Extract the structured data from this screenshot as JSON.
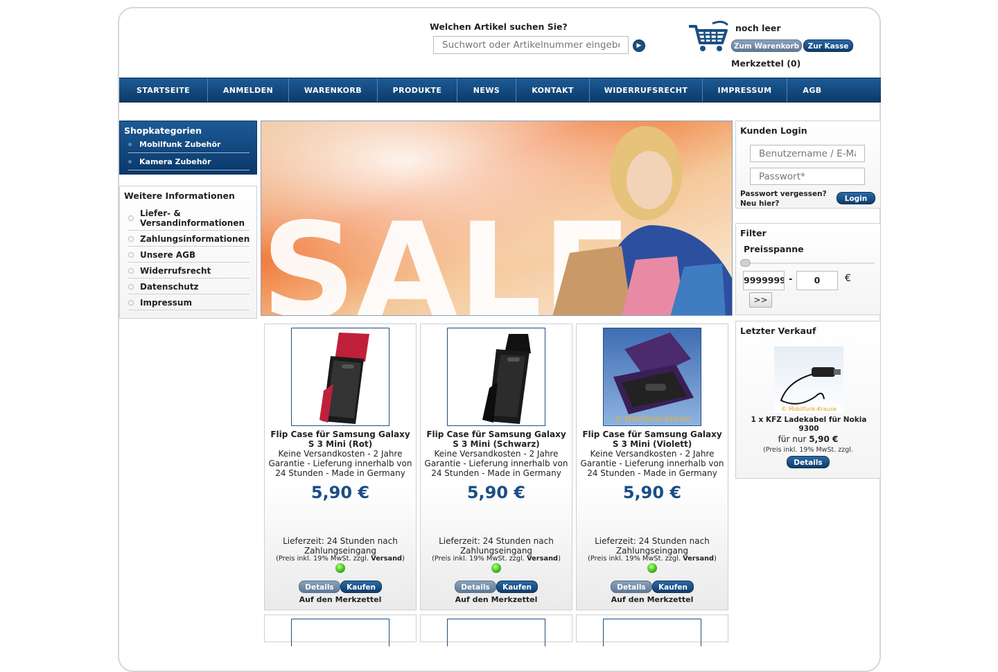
{
  "header": {
    "search_label": "Welchen Artikel suchen Sie?",
    "search_placeholder": "Suchwort oder Artikelnummer eingeben",
    "cart_status": "noch leer",
    "to_cart_label": "Zum Warenkorb",
    "checkout_label": "Zur Kasse",
    "wishlist_label": "Merkzettel (0)"
  },
  "nav": {
    "items": [
      "STARTSEITE",
      "ANMELDEN",
      "WARENKORB",
      "PRODUKTE",
      "NEWS",
      "KONTAKT",
      "WIDERRUFSRECHT",
      "IMPRESSUM",
      "AGB"
    ]
  },
  "categories": {
    "title": "Shopkategorien",
    "items": [
      "Mobilfunk Zubehör",
      "Kamera Zubehör"
    ]
  },
  "info": {
    "title": "Weitere Informationen",
    "items": [
      "Liefer- & Versandinformationen",
      "Zahlungsinformationen",
      "Unsere AGB",
      "Widerrufsrecht",
      "Datenschutz",
      "Impressum"
    ]
  },
  "banner": {
    "text": "SALE"
  },
  "login": {
    "title": "Kunden Login",
    "username_placeholder": "Benutzername / E-Mail",
    "password_placeholder": "Passwort*",
    "forgot_label": "Passwort vergessen?",
    "new_label": "Neu hier?",
    "login_button": "Login"
  },
  "filter": {
    "title": "Filter",
    "subtitle": "Preisspanne",
    "min_value": "9999999",
    "separator": "-",
    "max_value": "0",
    "currency": "€",
    "go_label": ">>"
  },
  "last_sale": {
    "title": "Letzter Verkauf",
    "name": "1 x KFZ Ladekabel für Nokia 9300",
    "price_prefix": "für nur",
    "price": "5,90 €",
    "vat": "(Preis inkl. 19% MwSt. zzgl.",
    "details_label": "Details",
    "image_watermark": "© Mobilfunk-Krause"
  },
  "products": [
    {
      "title": "Flip Case für Samsung Galaxy S 3 Mini (Rot)",
      "description": "Keine Versandkosten - 2 Jahre Garantie - Lieferung innerhalb von 24 Stunden - Made in Germany",
      "price": "5,90 €",
      "delivery": "Lieferzeit: 24 Stunden nach Zahlungseingang",
      "vat_prefix": "(Preis inkl. 19% MwSt. zzgl.",
      "vat_link": "Versand",
      "vat_suffix": ")",
      "details_label": "Details",
      "buy_label": "Kaufen",
      "wishlist_label": "Auf den Merkzettel",
      "color": "#c0203a"
    },
    {
      "title": "Flip Case für Samsung Galaxy S 3 Mini (Schwarz)",
      "description": "Keine Versandkosten - 2 Jahre Garantie - Lieferung innerhalb von 24 Stunden - Made in Germany",
      "price": "5,90 €",
      "delivery": "Lieferzeit: 24 Stunden nach Zahlungseingang",
      "vat_prefix": "(Preis inkl. 19% MwSt. zzgl.",
      "vat_link": "Versand",
      "vat_suffix": ")",
      "details_label": "Details",
      "buy_label": "Kaufen",
      "wishlist_label": "Auf den Merkzettel",
      "color": "#1a1a1a"
    },
    {
      "title": "Flip Case für Samsung Galaxy S 3 Mini (Violett)",
      "description": "Keine Versandkosten - 2 Jahre Garantie - Lieferung innerhalb von 24 Stunden - Made in Germany",
      "price": "5,90 €",
      "delivery": "Lieferzeit: 24 Stunden nach Zahlungseingang",
      "vat_prefix": "(Preis inkl. 19% MwSt. zzgl.",
      "vat_link": "Versand",
      "vat_suffix": ")",
      "details_label": "Details",
      "buy_label": "Kaufen",
      "wishlist_label": "Auf den Merkzettel",
      "color": "#4b2a6e",
      "image_watermark": "© Mobilfunk-Krause"
    }
  ]
}
